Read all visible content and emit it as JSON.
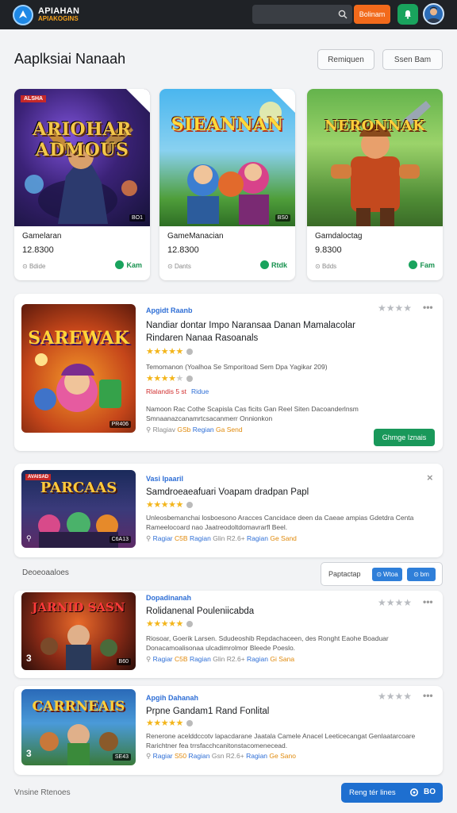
{
  "app": {
    "logo_line1": "APIAHAN",
    "logo_line2": "APIAKOGINS",
    "search_button": "Bolinam"
  },
  "header": {
    "title": "Aaplksiai Nanaah",
    "button1": "Remiquen",
    "button2": "Ssen Bam"
  },
  "featured": [
    {
      "art_title": "ARIOHAR ADMOUS",
      "tag": "ALSHA",
      "badge": "BO1",
      "name": "Gamelaran",
      "price": "12.8300",
      "meta": "Bdide",
      "action": "Kam"
    },
    {
      "art_title": "SIEANNAN",
      "tag": "",
      "badge": "BS0",
      "name": "GameManacian",
      "price": "12.8300",
      "meta": "Dants",
      "action": "Rtdk"
    },
    {
      "art_title": "NERONNAK",
      "tag": "",
      "badge": "",
      "name": "Gamdaloctag",
      "price": "9.8300",
      "meta": "Bdds",
      "action": "Fam"
    }
  ],
  "list": [
    {
      "art_title": "SAREWAK",
      "category": "Apgidt Raanb",
      "title": "Nandiar dontar Impo Naransaa Danan Mamalacolar Rindaren Nanaa Rasoanals",
      "desc1": "Temomanon (Yoalhoa Se Smporitoad Sem Dpa Yagikar 209)",
      "desc2": "Namoon Rac Cothe Scapisla Cas ficits Gan Reel Siten Dacoanderlnsm Smnaanazcanamrtcsacanmerr Onnionkon",
      "sub_red": "Rlalandis 5 st",
      "sub_blue": "Ridue",
      "meta": [
        "Rlagiav",
        "GSb",
        "Regian",
        "Ga Send"
      ],
      "badge": "PR406",
      "action": "Ghmge Iznais"
    },
    {
      "art_title": "PARCAAS",
      "tag": "AVAISAD",
      "category": "Vasi Ipaaril",
      "title": "Samdroeaeafuari Voapam dradpan Papl",
      "desc": "Unleosbemanchai losboesono Aracces Cancidace deen da Caeae ampias Gdetdra Centa Rameelocoard nao Jaatreodoltdomavrarfl Beel.",
      "meta": [
        "Ragiar",
        "C5B",
        "Ragian",
        "Glin",
        "R2.6+",
        "Ragian",
        "Ge Sand"
      ],
      "badge": "C6A13",
      "close": "×"
    },
    {
      "art_title": "JARNID SASN",
      "category": "Dopadinanah",
      "title": "Rolidanenal Pouleniicabda",
      "desc": "Riosoar, Goerik Larsen. Sdudeoshib Repdachaceen, des Ronght Eaohe Boaduar Donacamoalisonaa ulcadimrolmor Bleede Poeslo.",
      "meta": [
        "Ragiar",
        "C5B",
        "Ragian",
        "Glin",
        "R2.6+",
        "Ragian",
        "Gi Sana"
      ],
      "num": "3",
      "badge": "B60"
    },
    {
      "art_title": "CARRNEAIS",
      "category": "Apgih Dahanah",
      "title": "Prpne Gandam1 Rand Fonlital",
      "desc": "Renerone acelddccotv lapacdarane Jaatala Camele Anacel Leeticecangat Genlaatarcoare Rarichtner fea trrsfacchcanitonstacomenecead.",
      "meta": [
        "Ragiar",
        "S50",
        "Ragian",
        "Gsn",
        "R2.6+",
        "Ragian",
        "Ge Sano"
      ],
      "num": "3",
      "badge": "SE43"
    }
  ],
  "filter": {
    "section_label": "Deoeoaaloes",
    "label": "Paptactap",
    "chip1": "Wtoa",
    "chip2": "bm"
  },
  "footer": {
    "text": "Vnsine Rtenoes",
    "button": "Reng tér lines",
    "count": "BO"
  }
}
